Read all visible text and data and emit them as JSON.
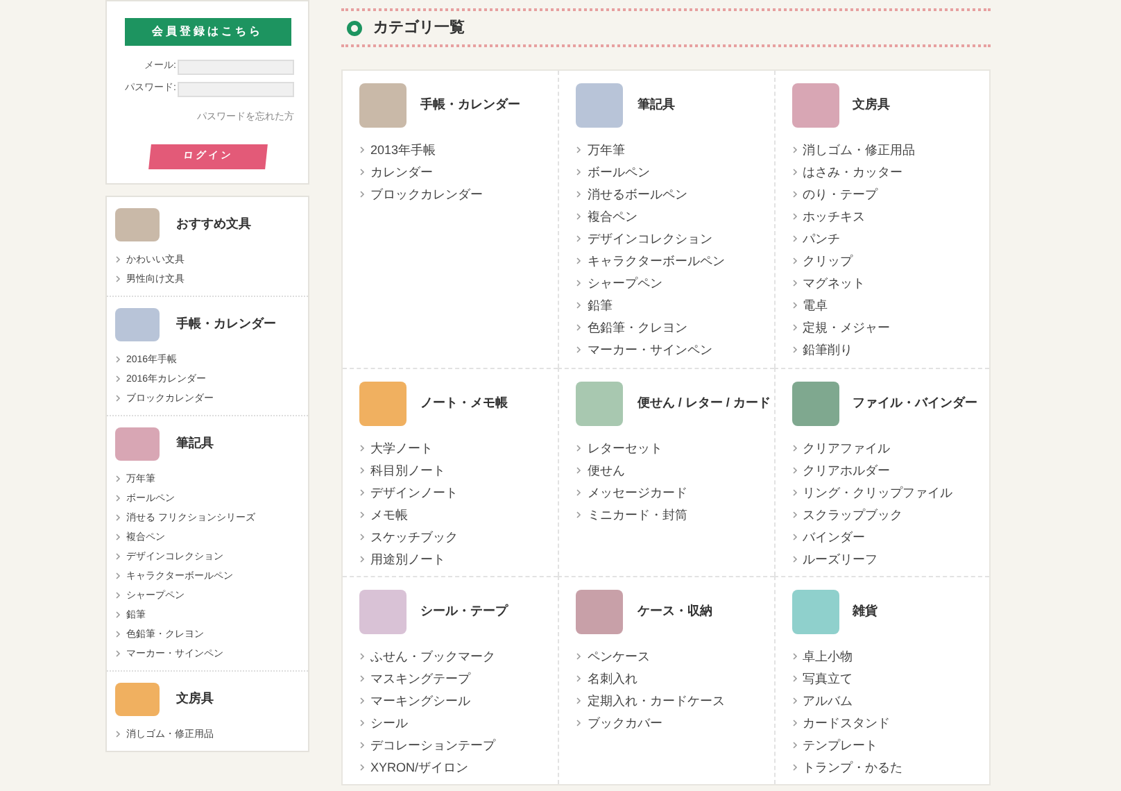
{
  "login": {
    "register_button": "会員登録はこちら",
    "fields": [
      {
        "label": "メール:"
      },
      {
        "label": "パスワード:"
      }
    ],
    "forgot_link": "パスワードを忘れた方",
    "login_button": "ログイン"
  },
  "sidebar": {
    "sections": [
      {
        "title": "おすすめ文具",
        "items": [
          "かわいい文具",
          "男性向け文具"
        ]
      },
      {
        "title": "手帳・カレンダー",
        "items": [
          "2016年手帳",
          "2016年カレンダー",
          "ブロックカレンダー"
        ]
      },
      {
        "title": "筆記具",
        "items": [
          "万年筆",
          "ボールペン",
          "消せる フリクションシリーズ",
          "複合ペン",
          "デザインコレクション",
          "キャラクターボールペン",
          "シャープペン",
          "鉛筆",
          "色鉛筆・クレヨン",
          "マーカー・サインペン"
        ]
      },
      {
        "title": "文房具",
        "items": [
          "消しゴム・修正用品"
        ]
      }
    ]
  },
  "main": {
    "title": "カテゴリ一覧",
    "categories": [
      {
        "title": "手帳・カレンダー",
        "items": [
          "2013年手帳",
          "カレンダー",
          "ブロックカレンダー"
        ]
      },
      {
        "title": "筆記具",
        "items": [
          "万年筆",
          "ボールペン",
          "消せるボールペン",
          "複合ペン",
          "デザインコレクション",
          "キャラクターボールペン",
          "シャープペン",
          "鉛筆",
          "色鉛筆・クレヨン",
          "マーカー・サインペン"
        ]
      },
      {
        "title": "文房具",
        "items": [
          "消しゴム・修正用品",
          "はさみ・カッター",
          "のり・テープ",
          "ホッチキス",
          "パンチ",
          "クリップ",
          "マグネット",
          "電卓",
          "定規・メジャー",
          "鉛筆削り"
        ]
      },
      {
        "title": "ノート・メモ帳",
        "items": [
          "大学ノート",
          "科目別ノート",
          "デザインノート",
          "メモ帳",
          "スケッチブック",
          "用途別ノート"
        ]
      },
      {
        "title": "便せん / レター / カード",
        "items": [
          "レターセット",
          "便せん",
          "メッセージカード",
          "ミニカード・封筒"
        ]
      },
      {
        "title": "ファイル・バインダー",
        "items": [
          "クリアファイル",
          "クリアホルダー",
          "リング・クリップファイル",
          "スクラップブック",
          "バインダー",
          "ルーズリーフ"
        ]
      },
      {
        "title": "シール・テープ",
        "items": [
          "ふせん・ブックマーク",
          "マスキングテープ",
          "マーキングシール",
          "シール",
          "デコレーションテープ",
          "XYRON/ザイロン"
        ]
      },
      {
        "title": "ケース・収納",
        "items": [
          "ペンケース",
          "名刺入れ",
          "定期入れ・カードケース",
          "ブックカバー"
        ]
      },
      {
        "title": "雑貨",
        "items": [
          "卓上小物",
          "写真立て",
          "アルバム",
          "カードスタンド",
          "テンプレート",
          "トランプ・かるた"
        ]
      }
    ]
  }
}
